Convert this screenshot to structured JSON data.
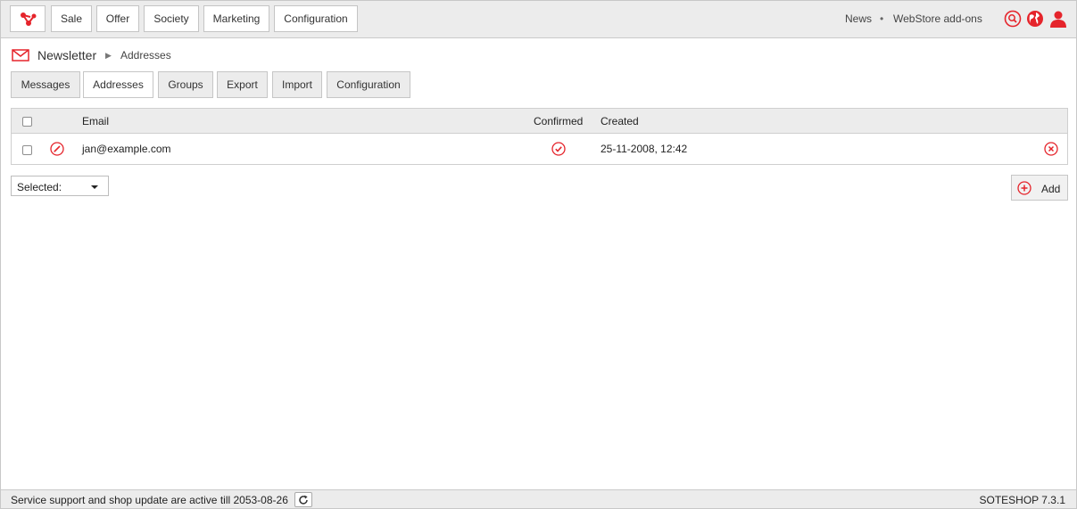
{
  "topbar": {
    "nav": [
      "Sale",
      "Offer",
      "Society",
      "Marketing",
      "Configuration"
    ],
    "links": {
      "news": "News",
      "separator": "•",
      "webstore": "WebStore add-ons"
    }
  },
  "breadcrumb": {
    "section": "Newsletter",
    "page": "Addresses"
  },
  "tabs": [
    "Messages",
    "Addresses",
    "Groups",
    "Export",
    "Import",
    "Configuration"
  ],
  "table": {
    "headers": {
      "email": "Email",
      "confirmed": "Confirmed",
      "created": "Created"
    },
    "rows": [
      {
        "email": "jan@example.com",
        "created": "25-11-2008, 12:42"
      }
    ]
  },
  "actions": {
    "selected_label": "Selected:",
    "add_label": "Add"
  },
  "footer": {
    "support_text": "Service support and shop update are active till 2053-08-26",
    "version": "SOTESHOP 7.3.1"
  },
  "colors": {
    "accent": "#e5242b"
  }
}
